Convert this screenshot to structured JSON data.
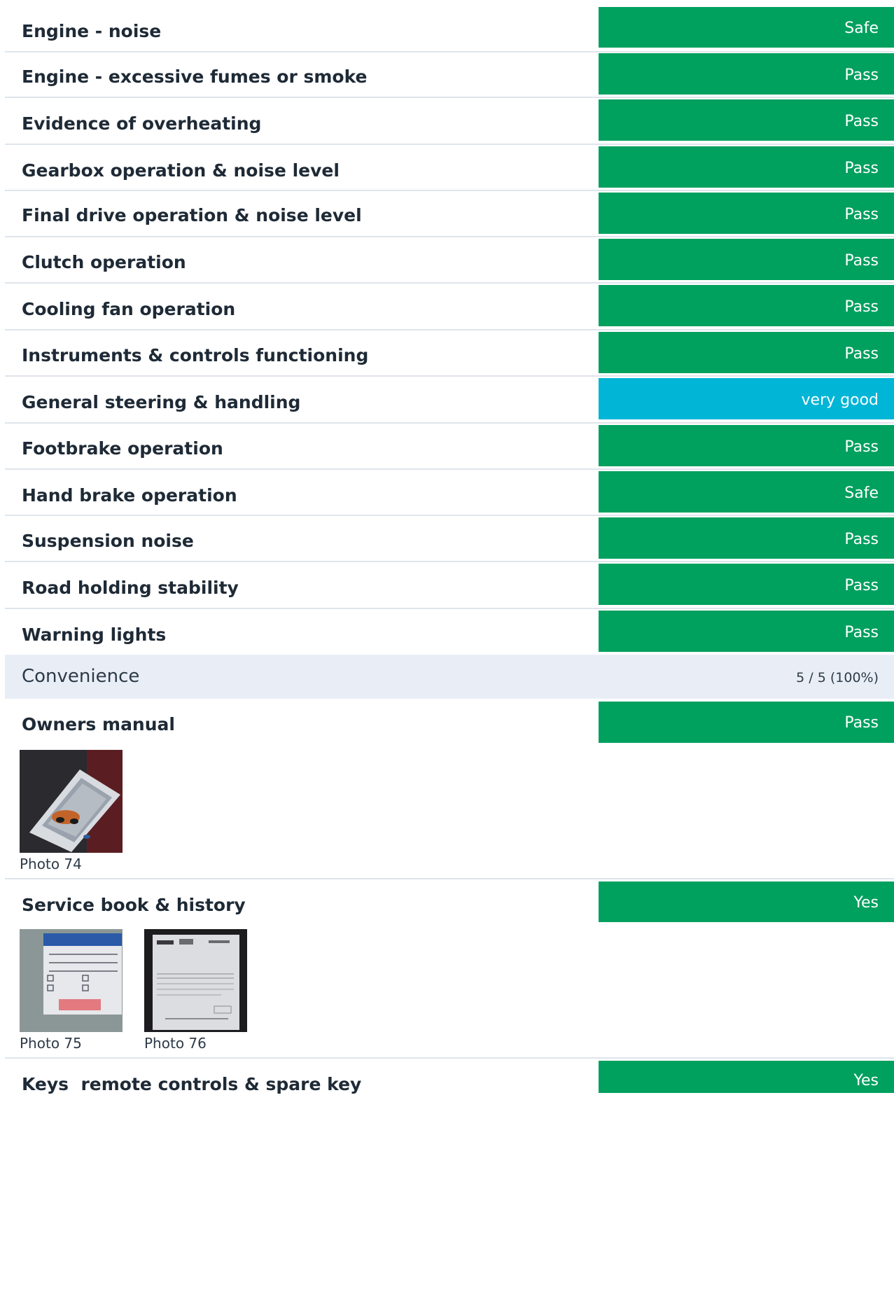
{
  "items": [
    {
      "label": "Engine - noise",
      "result": "Safe"
    },
    {
      "label": "Engine - excessive fumes or smoke",
      "result": "Pass"
    },
    {
      "label": "Evidence of overheating",
      "result": "Pass"
    },
    {
      "label": "Gearbox operation & noise level",
      "result": "Pass"
    },
    {
      "label": "Final drive operation & noise level",
      "result": "Pass"
    },
    {
      "label": "Clutch operation",
      "result": "Pass"
    },
    {
      "label": "Cooling fan operation",
      "result": "Pass"
    },
    {
      "label": "Instruments & controls functioning",
      "result": "Pass"
    },
    {
      "label": "General steering & handling",
      "result": "very good"
    },
    {
      "label": "Footbrake operation",
      "result": "Pass"
    },
    {
      "label": "Hand brake operation",
      "result": "Safe"
    },
    {
      "label": "Suspension noise",
      "result": "Pass"
    },
    {
      "label": "Road holding stability",
      "result": "Pass"
    },
    {
      "label": "Warning lights",
      "result": "Pass"
    }
  ],
  "convenience": {
    "title": "Convenience",
    "score": "5 / 5 (100%)",
    "items": [
      {
        "label": "Owners manual",
        "result": "Pass",
        "photos": [
          "Photo 74"
        ]
      },
      {
        "label": "Service book & history",
        "result": "Yes",
        "photos": [
          "Photo 75",
          "Photo 76"
        ]
      },
      {
        "label": "Keys  remote controls & spare key",
        "result": "Yes"
      }
    ]
  },
  "colors": {
    "pass_green": "#00a05f",
    "info_blue": "#00b5d6",
    "section_bg": "#e9eef6"
  }
}
